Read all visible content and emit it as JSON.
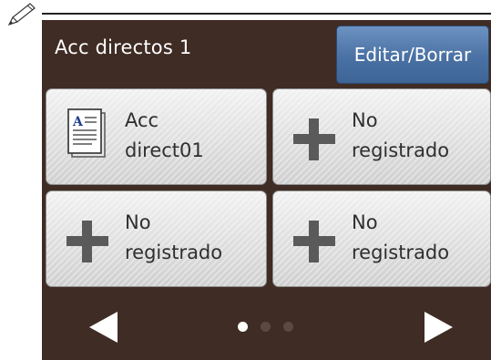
{
  "header": {
    "title": "Acc directos 1",
    "edit_label": "Editar/Borrar"
  },
  "tiles": [
    {
      "line1": "Acc",
      "line2": "direct01",
      "icon": "document-icon"
    },
    {
      "line1": "No",
      "line2": "registrado",
      "icon": "plus-icon"
    },
    {
      "line1": "No",
      "line2": "registrado",
      "icon": "plus-icon"
    },
    {
      "line1": "No",
      "line2": "registrado",
      "icon": "plus-icon"
    }
  ],
  "pagination": {
    "pages": 3,
    "current": 1
  },
  "colors": {
    "background": "#3f2c24",
    "edit_button": "#4a71a3",
    "tile": "#d9d9d9",
    "icon": "#5a5a5a"
  }
}
